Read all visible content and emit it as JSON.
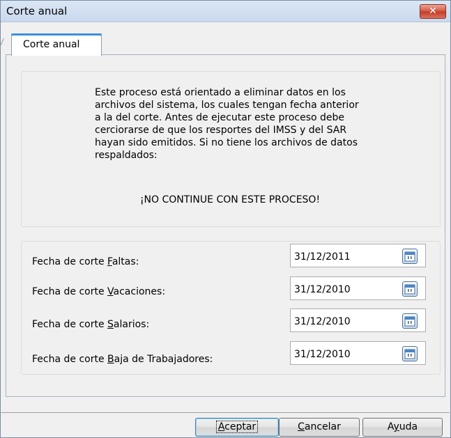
{
  "window": {
    "title": "Corte anual",
    "close_glyph": "✕"
  },
  "tab": {
    "label": "Corte anual"
  },
  "info": {
    "lines": [
      "Este proceso está orientado a eliminar datos en los",
      "archivos del sistema, los cuales tengan fecha anterior",
      "a la del corte. Antes de ejecutar este proceso debe",
      "cerciorarse de que los resportes del IMSS y del SAR",
      "hayan sido emitidos. Si no tiene los archivos de datos",
      "respaldados:"
    ],
    "warning": "¡NO CONTINUE CON ESTE PROCESO!"
  },
  "fields": [
    {
      "label_prefix": "Fecha de corte ",
      "label_mnemonic": "F",
      "label_rest": "altas:",
      "value": "31/12/2011",
      "icon": "calendar-icon"
    },
    {
      "label_prefix": "Fecha de corte ",
      "label_mnemonic": "V",
      "label_rest": "acaciones:",
      "value": "31/12/2010",
      "icon": "calendar-icon"
    },
    {
      "label_prefix": "Fecha de corte ",
      "label_mnemonic": "S",
      "label_rest": "alarios:",
      "value": "31/12/2010",
      "icon": "calendar-icon"
    },
    {
      "label_prefix": "Fecha de corte ",
      "label_mnemonic": "B",
      "label_rest": "aja de Trabajadores:",
      "value": "31/12/2010",
      "icon": "calendar-icon"
    }
  ],
  "buttons": {
    "accept": {
      "mnemonic": "A",
      "rest": "ceptar"
    },
    "cancel": {
      "mnemonic": "C",
      "rest": "ancelar"
    },
    "help": {
      "prefix": "A",
      "mnemonic": "y",
      "rest": "uda"
    }
  },
  "colors": {
    "tab_accent": "#3b8fdc",
    "close_button": "#c94731",
    "default_button_border": "#3c7fb1"
  }
}
